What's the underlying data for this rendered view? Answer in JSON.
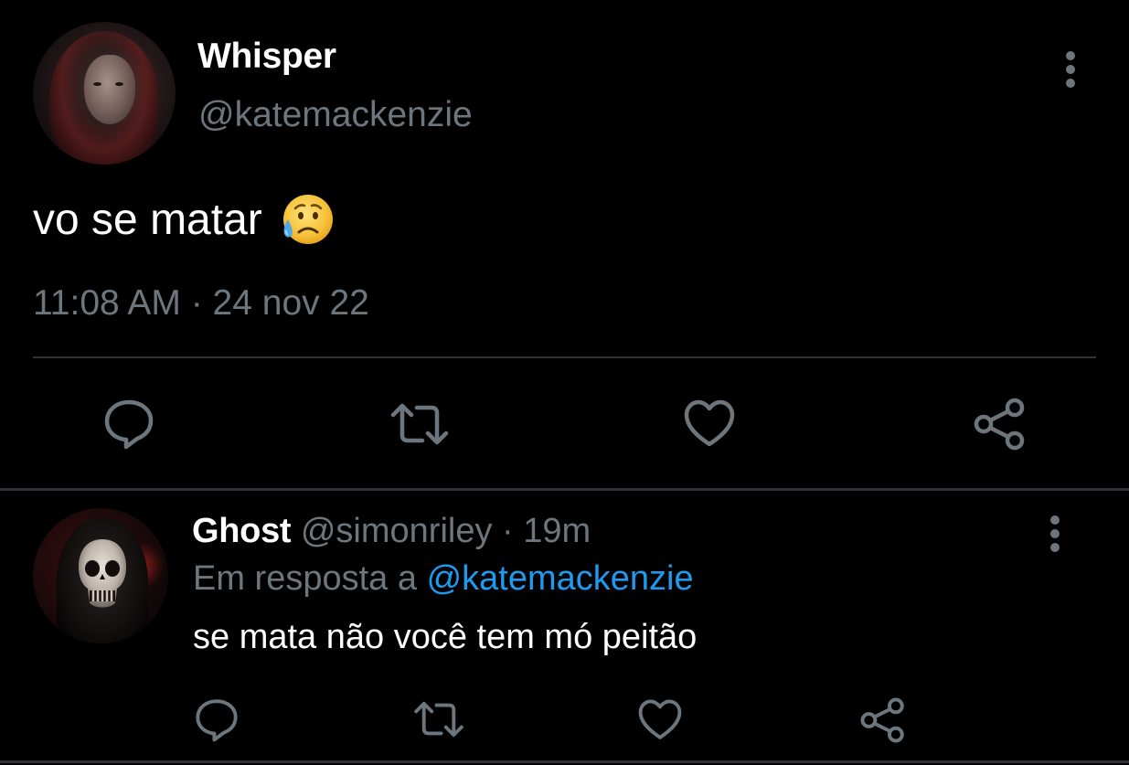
{
  "main_tweet": {
    "display_name": "Whisper",
    "handle": "@katemackenzie",
    "text": "vo se matar",
    "emoji": "sad-but-relieved-face-emoji",
    "timestamp": "11:08 AM · 24 nov 22",
    "actions": [
      "reply-icon",
      "retweet-icon",
      "like-icon",
      "share-icon"
    ]
  },
  "reply": {
    "display_name": "Ghost",
    "handle": "@simonriley",
    "time_ago": "19m",
    "separator": " · ",
    "reply_prefix": "Em resposta a ",
    "reply_mention": "@katemackenzie",
    "text": "se mata não você tem mó peitão",
    "actions": [
      "reply-icon",
      "retweet-icon",
      "like-icon",
      "share-icon"
    ]
  },
  "colors": {
    "background": "#000000",
    "primary_text": "#ffffff",
    "secondary_text": "#6e767d",
    "link": "#1d9bf0",
    "divider": "#2f3336"
  }
}
